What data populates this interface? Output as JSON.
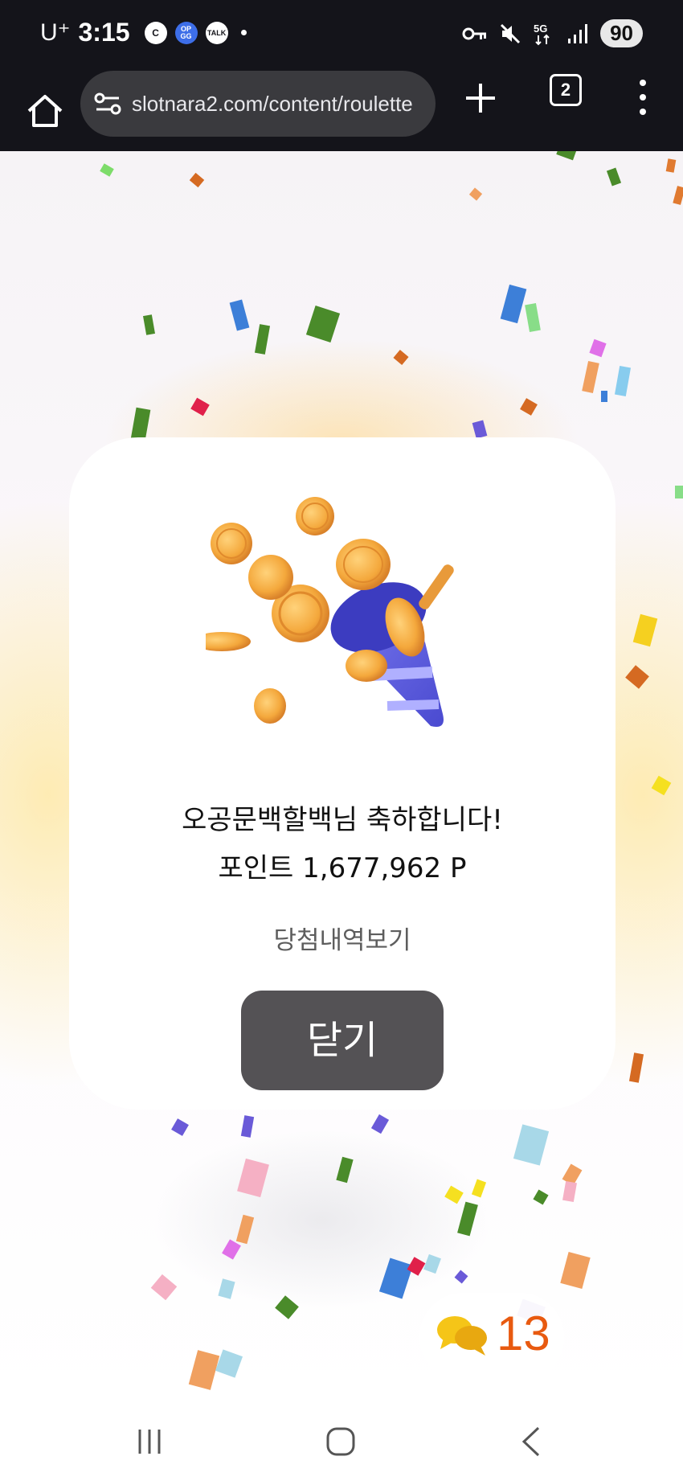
{
  "status_bar": {
    "carrier": "U⁺",
    "time": "3:15",
    "app_badges": [
      "C",
      "OP GG",
      "TALK"
    ],
    "network": "5G",
    "battery": "90"
  },
  "browser": {
    "url": "slotnara2.com/content/roulette",
    "tab_count": "2"
  },
  "popup": {
    "congrats_text": "오공문백할백님 축하합니다!",
    "points_text": "포인트 1,677,962 P",
    "history_link": "당첨내역보기",
    "close_button": "닫기"
  },
  "chat_widget": {
    "count": "13"
  },
  "colors": {
    "status_bg": "#14141a",
    "close_button_bg": "#545255",
    "chat_count": "#e85a10"
  }
}
